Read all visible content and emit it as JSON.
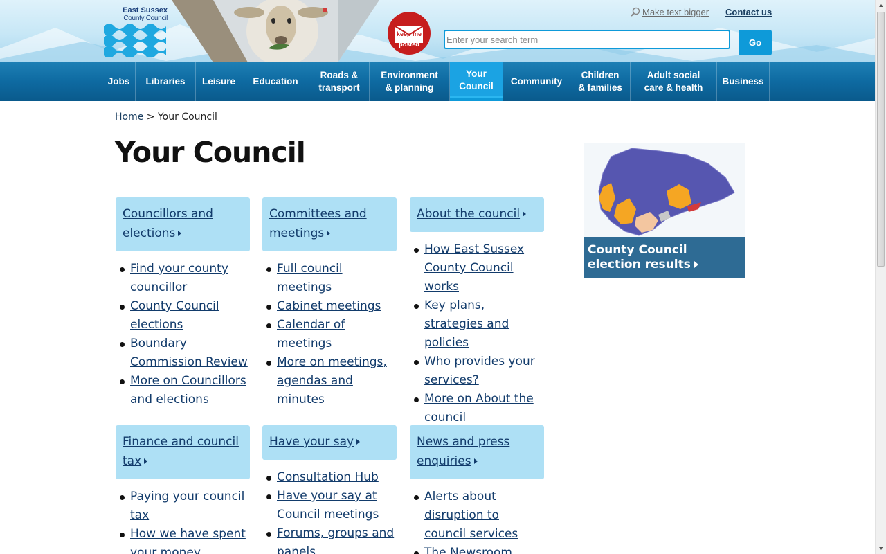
{
  "header": {
    "logo_line1": "East Sussex",
    "logo_line2": "County Council",
    "badge_line1": "keep me",
    "badge_line2": "posted",
    "make_text_bigger": "Make text bigger",
    "contact_us": "Contact us",
    "search_placeholder": "Enter your search term",
    "go_label": "Go"
  },
  "nav": [
    {
      "label": "Jobs",
      "active": false
    },
    {
      "label": "Libraries",
      "active": false
    },
    {
      "label": "Leisure",
      "active": false
    },
    {
      "label": "Education",
      "active": false
    },
    {
      "label": "Roads &\ntransport",
      "active": false
    },
    {
      "label": "Environment\n& planning",
      "active": false
    },
    {
      "label": "Your\nCouncil",
      "active": true
    },
    {
      "label": "Community",
      "active": false
    },
    {
      "label": "Children\n& families",
      "active": false
    },
    {
      "label": "Adult social\ncare & health",
      "active": false
    },
    {
      "label": "Business",
      "active": false
    }
  ],
  "breadcrumb": {
    "home": "Home",
    "separator": ">",
    "current": "Your Council"
  },
  "page_title": "Your Council",
  "cards": [
    {
      "title": "Councillors and elections",
      "links": [
        "Find your county councillor",
        "County Council elections",
        "Boundary Commission Review",
        "More on Councillors and elections"
      ]
    },
    {
      "title": "Committees and meetings",
      "links": [
        "Full council meetings",
        "Cabinet meetings",
        "Calendar of meetings",
        "More on meetings, agendas and minutes"
      ]
    },
    {
      "title": "About the council",
      "links": [
        "How East Sussex County Council works",
        "Key plans, strategies and policies",
        "Who provides your services?",
        "More on About the council"
      ]
    },
    {
      "title": "Finance and council tax",
      "links": [
        "Paying your council tax",
        "How we have spent your money"
      ]
    },
    {
      "title": "Have your say",
      "links": [
        "Consultation Hub",
        "Have your say at Council meetings",
        "Forums, groups and panels"
      ]
    },
    {
      "title": "News and press enquiries",
      "links": [
        "Alerts about disruption to council services",
        "The Newsroom"
      ]
    }
  ],
  "aside": {
    "caption": "County Council election results"
  },
  "colors": {
    "accent": "#0e9ad9",
    "nav": "#0e6aa1",
    "card": "#aee0f5",
    "link": "#123b6b",
    "aside_caption": "#2e6b94"
  }
}
